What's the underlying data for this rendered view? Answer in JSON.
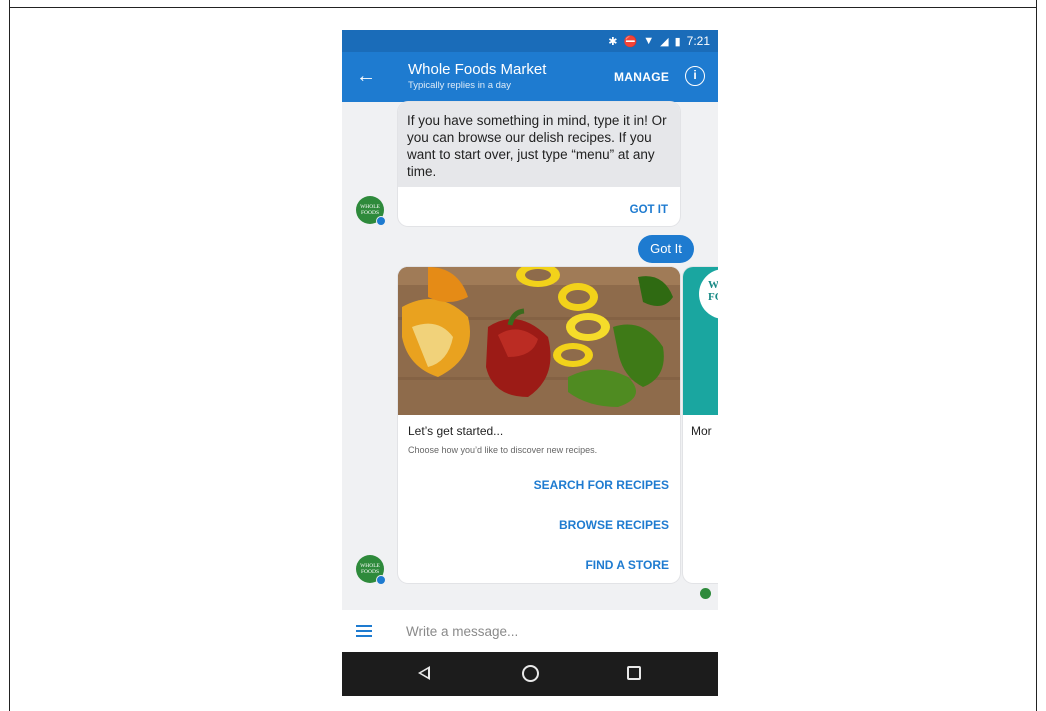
{
  "status_bar": {
    "time": "7:21",
    "icons": [
      "bluetooth-icon",
      "do-not-disturb-icon",
      "wifi-icon",
      "signal-icon",
      "battery-icon"
    ]
  },
  "header": {
    "title": "Whole Foods Market",
    "subtitle": "Typically replies in a day",
    "manage_label": "MANAGE",
    "info_glyph": "i"
  },
  "messages": {
    "bot_text": "If you have something in mind, type it in! Or you can browse our delish recipes. If you want to start over, just type “menu” at any time.",
    "bot_button": "GOT IT",
    "user_reply": "Got It"
  },
  "carousel": {
    "cards": [
      {
        "title": "Let’s get started...",
        "subtitle": "Choose how you’d like to discover new recipes.",
        "image": "bell-peppers-photo",
        "buttons": [
          "SEARCH FOR RECIPES",
          "BROWSE RECIPES",
          "FIND A STORE"
        ]
      },
      {
        "title": "Mor",
        "logo_text": "WHOLE FOODS"
      }
    ]
  },
  "avatar_text": "WHOLE FOODS",
  "composer": {
    "placeholder": "Write a message..."
  },
  "colors": {
    "brand_blue": "#1e7bd0",
    "status_blue": "#1a6cb9",
    "whole_foods_green": "#2e8a3b",
    "teal": "#1aa6a0"
  }
}
